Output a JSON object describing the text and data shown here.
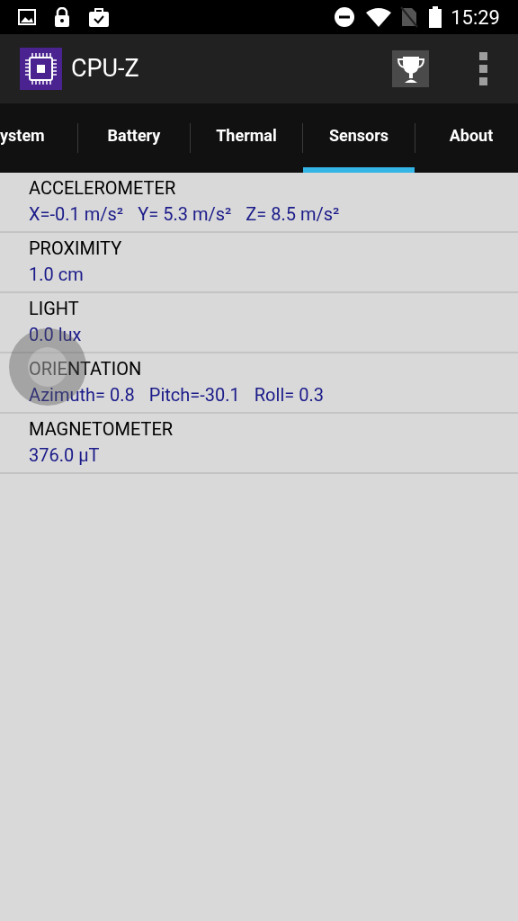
{
  "status_bar": {
    "time": "15:29"
  },
  "app_bar": {
    "title": "CPU-Z"
  },
  "tabs": [
    {
      "label": "ystem",
      "selected": false
    },
    {
      "label": "Battery",
      "selected": false
    },
    {
      "label": "Thermal",
      "selected": false
    },
    {
      "label": "Sensors",
      "selected": true
    },
    {
      "label": "About",
      "selected": false
    }
  ],
  "sensors": [
    {
      "name": "ACCELEROMETER",
      "values": [
        "X=-0.1 m/s²",
        "Y= 5.3 m/s²",
        "Z= 8.5 m/s²"
      ]
    },
    {
      "name": "PROXIMITY",
      "values": [
        "1.0 cm"
      ]
    },
    {
      "name": "LIGHT",
      "values": [
        "0.0 lux"
      ]
    },
    {
      "name": "ORIENTATION",
      "values": [
        "Azimuth= 0.8",
        "Pitch=-30.1",
        "Roll= 0.3"
      ]
    },
    {
      "name": "MAGNETOMETER",
      "values": [
        "376.0 µT"
      ]
    }
  ]
}
